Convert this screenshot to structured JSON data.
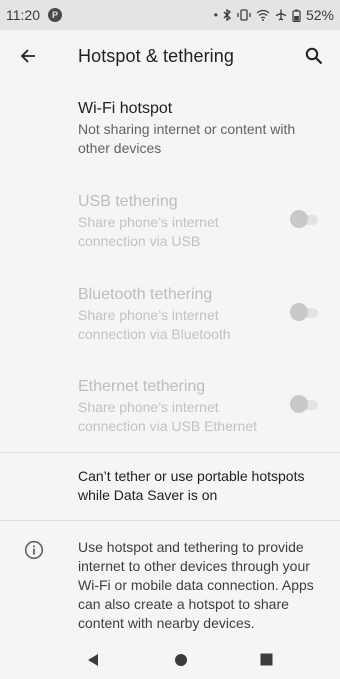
{
  "status_bar": {
    "time": "11:20",
    "app_icon": "P",
    "icons": [
      "dot-icon",
      "bluetooth-icon",
      "vibrate-icon",
      "wifi-icon",
      "airplane-icon",
      "battery-icon"
    ],
    "battery": "52%"
  },
  "app_bar": {
    "title": "Hotspot & tethering"
  },
  "items": [
    {
      "title": "Wi-Fi hotspot",
      "summary": "Not sharing internet or content with other devices",
      "enabled": true
    },
    {
      "title": "USB tethering",
      "summary": "Share phone’s internet connection via USB",
      "enabled": false,
      "toggle_on": false
    },
    {
      "title": "Bluetooth tethering",
      "summary": "Share phone’s internet connection via Bluetooth",
      "enabled": false,
      "toggle_on": false
    },
    {
      "title": "Ethernet tethering",
      "summary": "Share phone’s internet connection via USB Ethernet",
      "enabled": false,
      "toggle_on": false
    }
  ],
  "data_saver_note": "Can’t tether or use portable hotspots while Data Saver is on",
  "footer_info": "Use hotspot and tethering to provide internet to other devices through your Wi-Fi or mobile data connection. Apps can also create a hotspot to share content with nearby devices.",
  "colors": {
    "background": "#f5f5f5",
    "status_bar": "#e4e4e4",
    "text_primary": "#202124",
    "text_secondary": "#5f6368",
    "text_disabled": "#bdbdbd"
  }
}
